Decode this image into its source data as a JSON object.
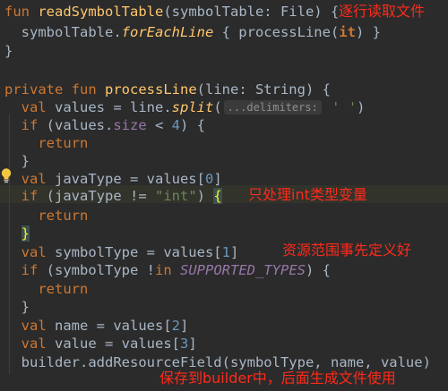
{
  "code": {
    "l1": {
      "kw": "fun",
      "name": "readSymbolTable",
      "rest": "(symbolTable: File) {"
    },
    "l2": {
      "a": "symbolTable.",
      "ext": "forEachLine",
      "b": " { processLine(",
      "it": "it",
      "c": ") }"
    },
    "l3": "}",
    "l5": {
      "kw": "private fun",
      "name": "processLine",
      "rest": "(line: String) {"
    },
    "l6": {
      "kw": "val",
      "a": " values = line.",
      "ext": "split",
      "b": "(",
      "hint": "...delimiters:",
      "str": "' '",
      "c": ")"
    },
    "l7": {
      "kw": "if",
      "a": " (values.",
      "prop": "size",
      "b": " < ",
      "num": "4",
      "c": ") {"
    },
    "l8": {
      "kw": "return"
    },
    "l9": "}",
    "l10": {
      "kw": "val",
      "a": " javaType = values[",
      "num": "0",
      "c": "]"
    },
    "l11": {
      "kw": "if",
      "a": " (javaType != ",
      "str": "\"int\"",
      "b": ") ",
      "brace": "{"
    },
    "l12": {
      "kw": "return"
    },
    "l13": {
      "brace": "}"
    },
    "l14": {
      "kw": "val",
      "a": " symbolType = values[",
      "num": "1",
      "c": "]"
    },
    "l15": {
      "kw": "if",
      "a": " (symbolType !",
      "kw2": "in",
      "b": " ",
      "const": "SUPPORTED_TYPES",
      "c": ") {"
    },
    "l16": {
      "kw": "return"
    },
    "l17": "}",
    "l18": {
      "kw": "val",
      "a": " name = values[",
      "num": "2",
      "c": "]"
    },
    "l19": {
      "kw": "val",
      "a": " value = values[",
      "num": "3",
      "c": "]"
    },
    "l20": {
      "a": "builder.addResourceField(symbolType, name, value)"
    }
  },
  "annotations": {
    "a1": "逐行读取文件",
    "a2": "只处理int类型变量",
    "a3": "资源范围事先定义好",
    "a4": "保存到builder中，后面生成文件使用"
  },
  "colors": {
    "background": "#2b2b2b",
    "keyword": "#cc7832",
    "function": "#ffc66d",
    "number": "#6897bb",
    "string": "#6a8759",
    "annotation": "#ff2a1a"
  },
  "icons": {
    "bulb": "lightbulb-icon"
  }
}
